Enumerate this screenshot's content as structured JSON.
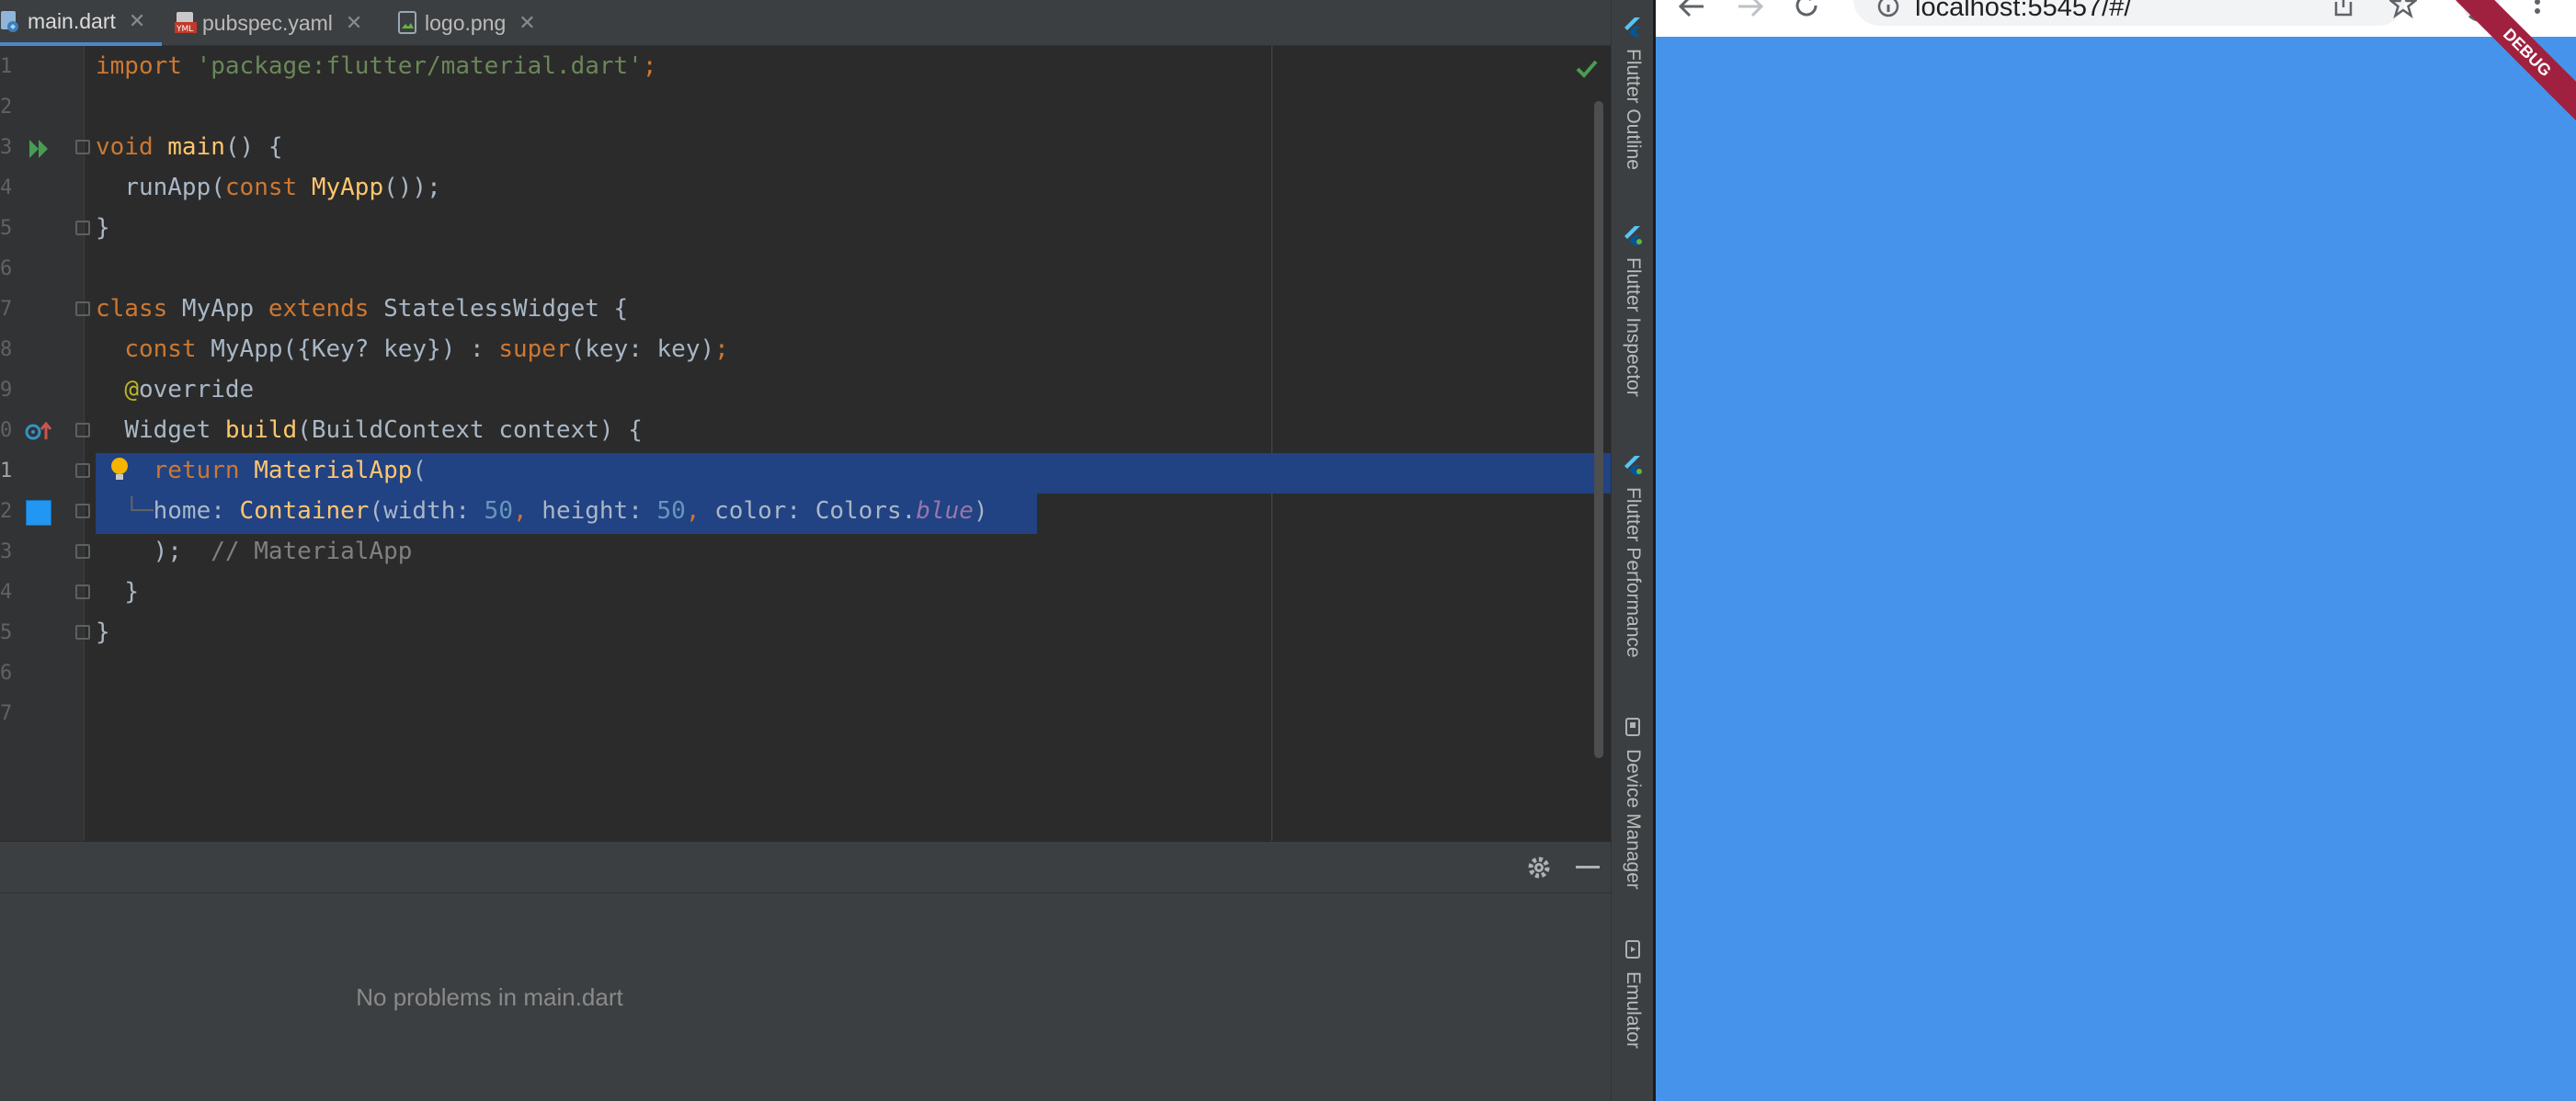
{
  "tabs": [
    {
      "label": "main.dart",
      "icon": "dart-file-icon",
      "active": true
    },
    {
      "label": "pubspec.yaml",
      "icon": "yaml-file-icon",
      "active": false
    },
    {
      "label": "logo.png",
      "icon": "image-file-icon",
      "active": false
    }
  ],
  "line_numbers": [
    "1",
    "2",
    "3",
    "4",
    "5",
    "6",
    "7",
    "8",
    "9",
    "0",
    "1",
    "2",
    "3",
    "4",
    "5",
    "6",
    "7"
  ],
  "code": {
    "import_kw": "import",
    "import_path": "'package:flutter/material.dart'",
    "semi": ";",
    "void_kw": "void",
    "main_fn": "main",
    "main_tail": "() {",
    "runapp": "runApp(",
    "const_kw": "const",
    "myapp": "MyApp",
    "runapp_tail": "());",
    "close_brace": "}",
    "class_kw": "class",
    "class_name": " MyApp ",
    "extends_kw": "extends",
    "class_tail": " StatelessWidget {",
    "ctor_const": "const",
    "ctor_body": " MyApp({Key? key}) : ",
    "super_kw": "super",
    "ctor_tail": "(key: key)",
    "override_at": "@",
    "override_word": "override",
    "widget_type": "Widget ",
    "build_fn": "build",
    "build_tail": "(BuildContext context) {",
    "return_kw": "return",
    "materialapp": "MaterialApp",
    "paren_open": "(",
    "tree_guide": "└─",
    "home_key": "home: ",
    "container": "Container",
    "width_key": "(width: ",
    "width_val": "50",
    "comma": ",",
    "height_key": " height: ",
    "height_val": "50",
    "color_key": " color: Colors.",
    "color_val": "blue",
    "paren_close": ")",
    "close_paren_semi": ");",
    "trailing_comment": "// MaterialApp"
  },
  "problems": {
    "empty_message": "No problems in main.dart"
  },
  "tool_windows": [
    {
      "label": "Flutter Outline",
      "icon": "flutter-icon"
    },
    {
      "label": "Flutter Inspector",
      "icon": "flutter-icon"
    },
    {
      "label": "Flutter Performance",
      "icon": "flutter-icon"
    },
    {
      "label": "Device Manager",
      "icon": "device-manager-icon"
    },
    {
      "label": "Emulator",
      "icon": "emulator-icon"
    }
  ],
  "browser": {
    "url": "localhost:55457/#/",
    "debug_banner": "DEBUG",
    "background_color": "#4593ea"
  },
  "colors": {
    "selection": "#214283",
    "keyword": "#cc7832",
    "string": "#6a8759",
    "function": "#ffc66d",
    "number": "#6897bb",
    "preview_swatch": "#2196f3"
  }
}
